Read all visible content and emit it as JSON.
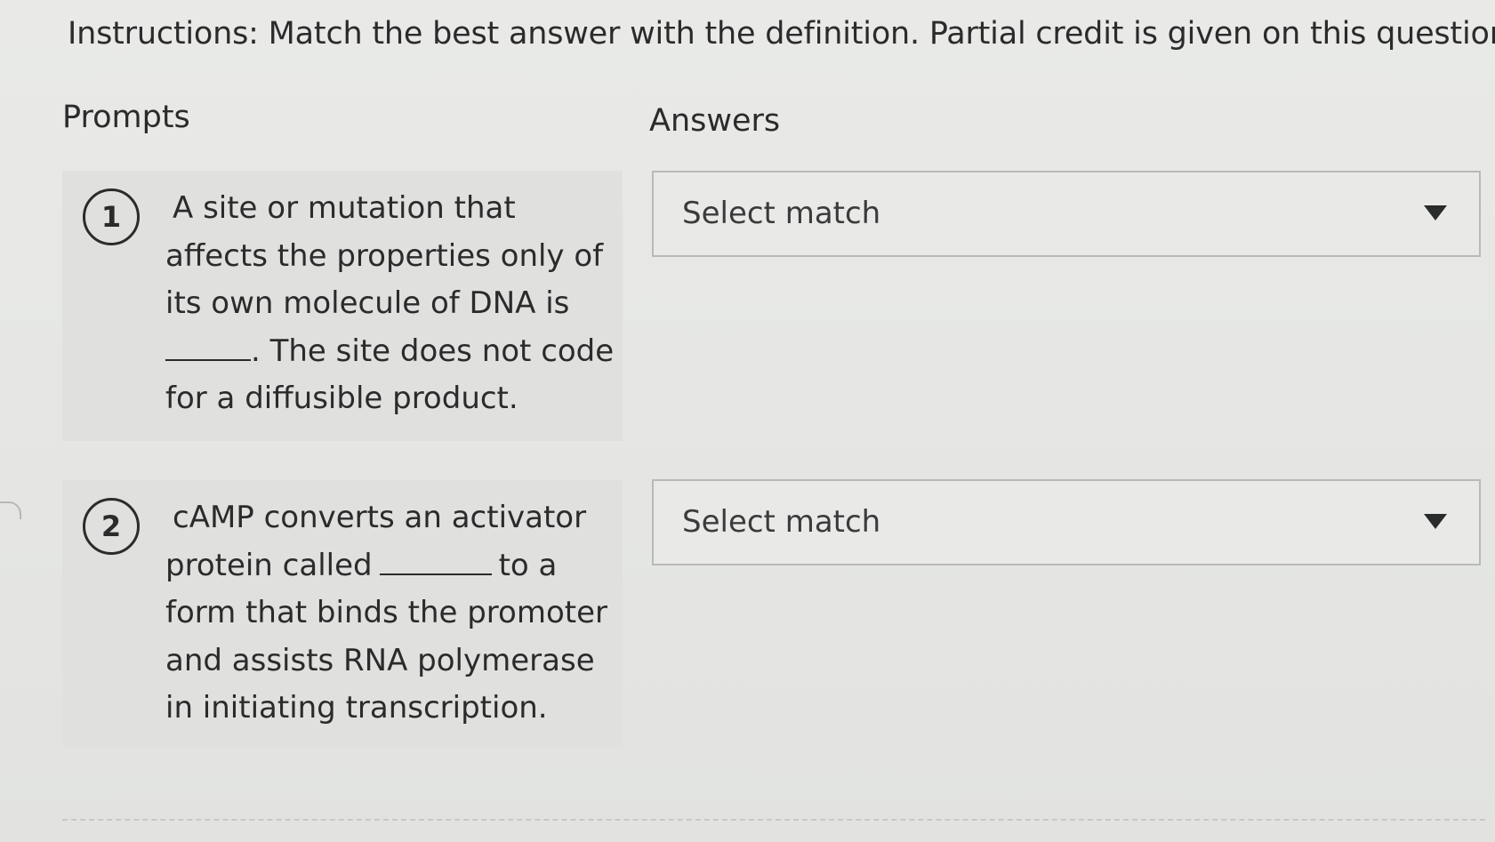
{
  "instructions": "Instructions: Match the best answer with the definition. Partial credit is given on this question.",
  "headers": {
    "prompts": "Prompts",
    "answers": "Answers"
  },
  "prompts": [
    {
      "number": "1",
      "text_before_blank_lines": [
        "A site or mutation that",
        "affects the properties only of",
        "its own molecule of DNA is"
      ],
      "text_after_blank": ". The site does not code",
      "last_line": "for a diffusible product."
    },
    {
      "number": "2",
      "line1": "cAMP converts an activator",
      "line2_before_blank": "protein called",
      "line2_after_blank": "to a",
      "line3": "form that binds the promoter",
      "line4": "and assists RNA polymerase",
      "line5": "in initiating transcription."
    }
  ],
  "answers": [
    {
      "selected_label": "Select match",
      "icon": "caret-down-icon"
    },
    {
      "selected_label": "Select match",
      "icon": "caret-down-icon"
    }
  ]
}
